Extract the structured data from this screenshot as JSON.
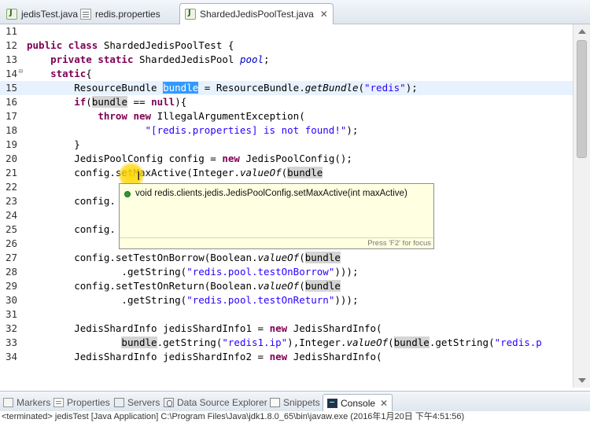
{
  "tabs": [
    {
      "label": "jedisTest.java",
      "icon": "java-file-icon"
    },
    {
      "label": "redis.properties",
      "icon": "properties-file-icon"
    },
    {
      "label": "ShardedJedisPoolTest.java",
      "icon": "java-file-icon",
      "active": true
    }
  ],
  "tab_close_glyph": "✕",
  "editor": {
    "current_line": "15",
    "lines": [
      {
        "n": "11"
      },
      {
        "n": "12"
      },
      {
        "n": "13"
      },
      {
        "n": "14",
        "fold": "⊖"
      },
      {
        "n": "15"
      },
      {
        "n": "16"
      },
      {
        "n": "17"
      },
      {
        "n": "18"
      },
      {
        "n": "19"
      },
      {
        "n": "20"
      },
      {
        "n": "21"
      },
      {
        "n": "22"
      },
      {
        "n": "23"
      },
      {
        "n": "24"
      },
      {
        "n": "25"
      },
      {
        "n": "26"
      },
      {
        "n": "27"
      },
      {
        "n": "28"
      },
      {
        "n": "29"
      },
      {
        "n": "30"
      },
      {
        "n": "31"
      },
      {
        "n": "32"
      },
      {
        "n": "33"
      },
      {
        "n": "34"
      }
    ],
    "tokens": {
      "l12": {
        "a": "public class ",
        "b": "ShardedJedisPoolTest {"
      },
      "l13": {
        "a": "private static ",
        "b": "ShardedJedisPool ",
        "c": "pool",
        "d": ";"
      },
      "l14": {
        "a": "static",
        "b": "{"
      },
      "l15": {
        "a": "ResourceBundle ",
        "b": "bundle",
        "c": " = ResourceBundle.",
        "d": "getBundle",
        "e": "(",
        "f": "\"redis\"",
        "g": ");"
      },
      "l16": {
        "a": "if",
        "b": "(",
        "c": "bundle",
        "d": " == ",
        "e": "null",
        "f": "){"
      },
      "l17": {
        "a": "throw new ",
        "b": "IllegalArgumentException("
      },
      "l18": {
        "a": "\"[redis.properties] is not found!\"",
        "b": ");"
      },
      "l19": {
        "a": "}"
      },
      "l20": {
        "a": "JedisPoolConfig config = ",
        "b": "new ",
        "c": "JedisPoolConfig();"
      },
      "l21": {
        "a": "config.setMaxActive(Integer.",
        "b": "valueOf",
        "c": "(",
        "d": "bundle"
      },
      "l23": {
        "a": "config."
      },
      "l25": {
        "a": "config."
      },
      "l27": {
        "a": "config.setTestOnBorrow(Boolean.",
        "b": "valueOf",
        "c": "(",
        "d": "bundle"
      },
      "l28": {
        "a": ".getString(",
        "b": "\"redis.pool.testOnBorrow\"",
        "c": ")));"
      },
      "l29": {
        "a": "config.setTestOnReturn(Boolean.",
        "b": "valueOf",
        "c": "(",
        "d": "bundle"
      },
      "l30": {
        "a": ".getString(",
        "b": "\"redis.pool.testOnReturn\"",
        "c": ")));"
      },
      "l32": {
        "a": "JedisShardInfo jedisShardInfo1 = ",
        "b": "new ",
        "c": "JedisShardInfo("
      },
      "l33": {
        "a": "bundle",
        "b": ".getString(",
        "c": "\"redis1.ip\"",
        "d": "),Integer.",
        "e": "valueOf",
        "f": "(",
        "g": "bundle",
        "h": ".getString(",
        "i": "\"redis.p"
      },
      "l34": {
        "a": "JedisShardInfo jedisShardInfo2 = ",
        "b": "new ",
        "c": "JedisShardInfo("
      }
    }
  },
  "popup": {
    "signature": "void redis.clients.jedis.JedisPoolConfig.setMaxActive(int maxActive)",
    "focus_hint": "Press 'F2' for focus"
  },
  "bottom_views": [
    {
      "label": "Markers",
      "icon": "markers-icon"
    },
    {
      "label": "Properties",
      "icon": "properties-icon"
    },
    {
      "label": "Servers",
      "icon": "servers-icon"
    },
    {
      "label": "Data Source Explorer",
      "icon": "data-source-explorer-icon"
    },
    {
      "label": "Snippets",
      "icon": "snippets-icon"
    },
    {
      "label": "Console",
      "icon": "console-icon",
      "active": true
    }
  ],
  "console_status": "<terminated> jedisTest [Java Application] C:\\Program Files\\Java\\jdk1.8.0_65\\bin\\javaw.exe (2016年1月20日 下午4:51:56)"
}
